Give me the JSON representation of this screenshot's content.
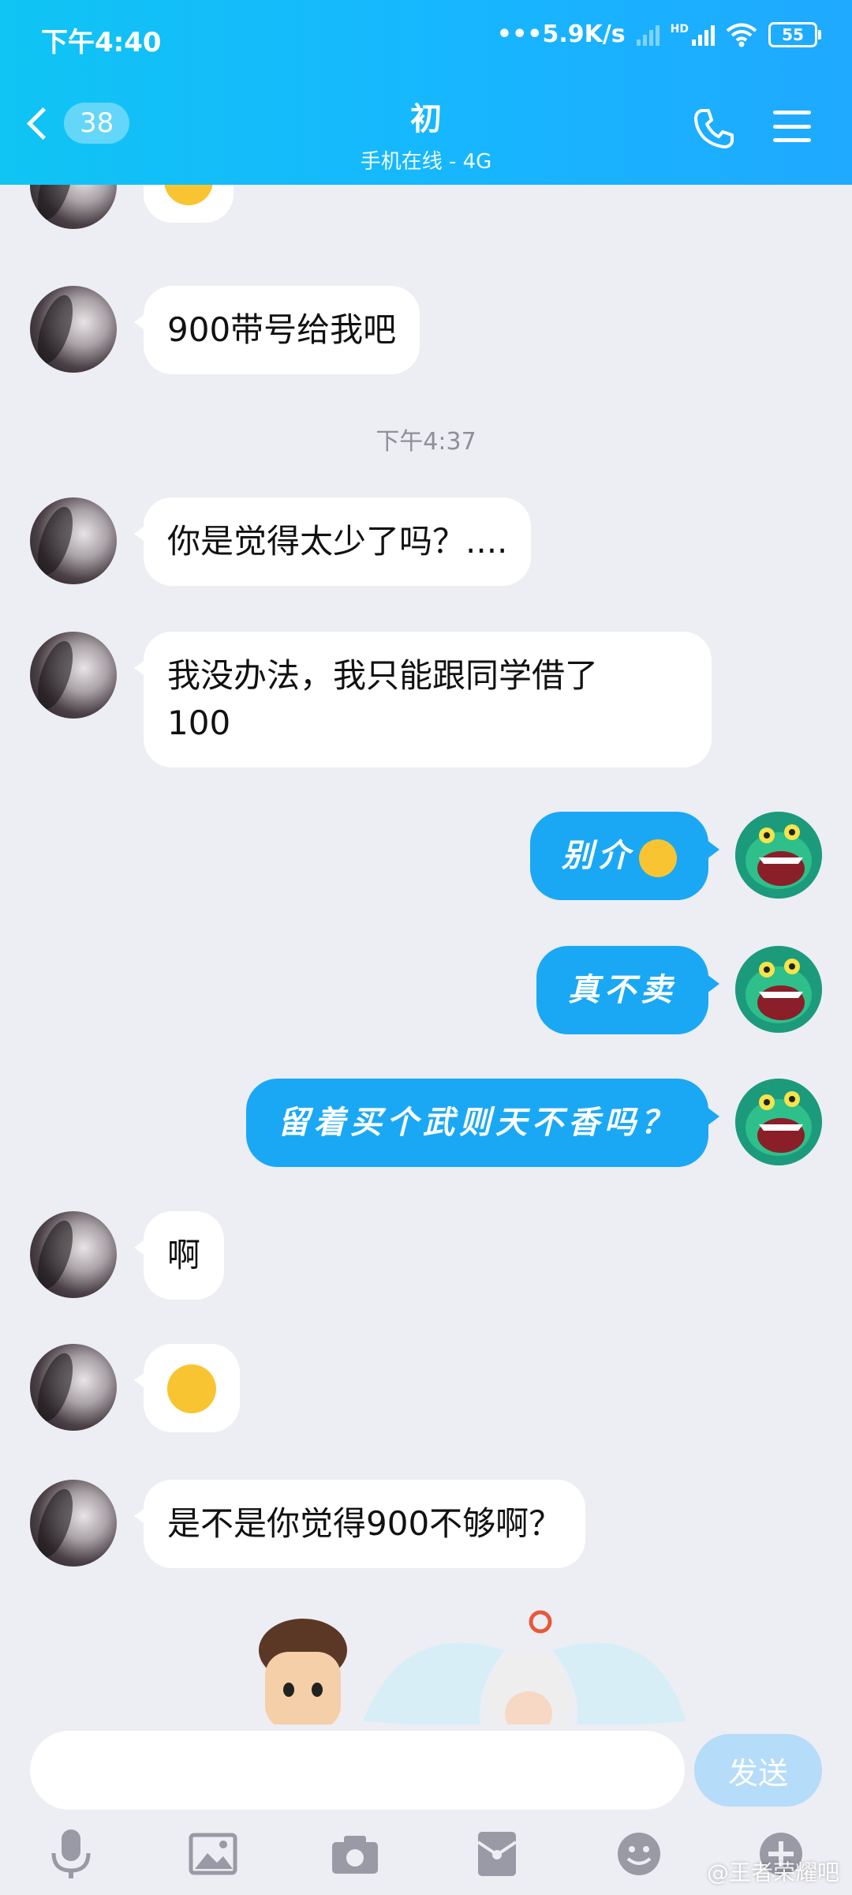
{
  "status_bar": {
    "time": "下午4:40",
    "network_speed": "•••5.9K/s",
    "signal_hd": "HD",
    "battery": "55"
  },
  "header": {
    "unread_count": "38",
    "title": "初",
    "subtitle": "手机在线 - 4G",
    "icons": [
      "chevron-left-icon",
      "phone-icon",
      "menu-icon"
    ]
  },
  "messages": {
    "m1_text": "900带号给我吧",
    "timestamp": "下午4:37",
    "m2_text": "你是觉得太少了吗？....",
    "m3_line1": "我没办法，我只能跟同学借了",
    "m3_line2": "100",
    "m4_text": "别介",
    "m5_text": "真不卖",
    "m6_text": "留着买个武则天不香吗？",
    "m7_text": "啊",
    "m9_text": "是不是你觉得900不够啊？"
  },
  "input": {
    "placeholder": "",
    "send_label": "发送"
  },
  "toolbar": {
    "icons": [
      "microphone-icon",
      "image-icon",
      "camera-icon",
      "red-packet-icon",
      "emoji-icon",
      "plus-icon"
    ]
  },
  "watermark": "@王者荣耀吧",
  "colors": {
    "header": "#17b6ff",
    "outgoing_bubble": "#1aa8f5",
    "incoming_bubble": "#ffffff",
    "background": "#ededf4",
    "send_button": "#b5dcf8"
  }
}
